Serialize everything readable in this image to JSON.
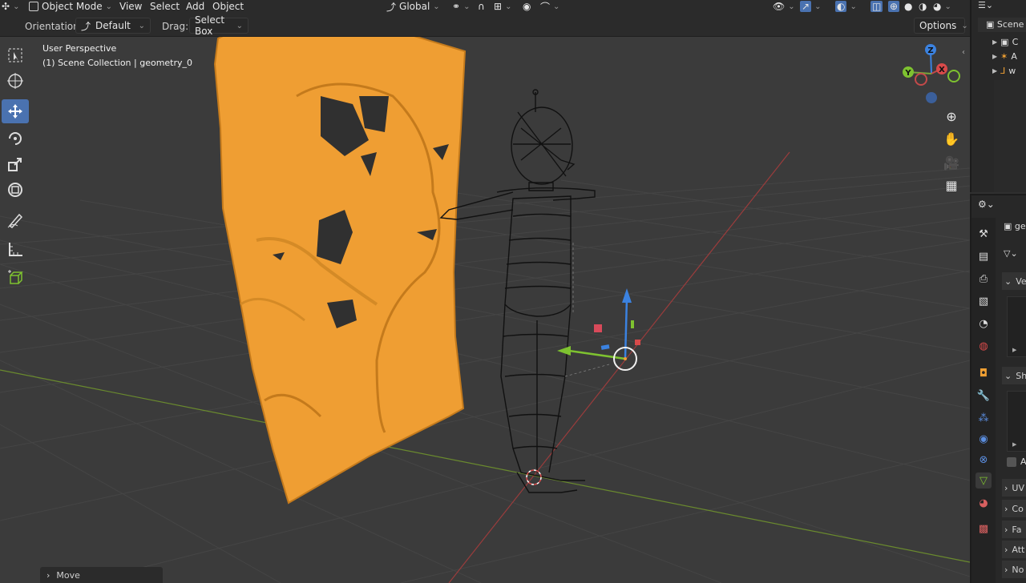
{
  "header": {
    "mode": "Object Mode",
    "menus": [
      "View",
      "Select",
      "Add",
      "Object"
    ],
    "transform_orientation": "Global",
    "orientation_label": "Orientation:",
    "orientation_value": "Default",
    "drag_label": "Drag:",
    "drag_value": "Select Box",
    "options_label": "Options"
  },
  "viewport": {
    "perspective": "User Perspective",
    "collection": "(1) Scene Collection | geometry_0",
    "gizmo_axes": [
      "Z",
      "X",
      "Y"
    ],
    "last_operator": "Move"
  },
  "toolbar": {
    "tools": [
      "select-box",
      "cursor",
      "move",
      "rotate",
      "scale",
      "transform",
      "annotate",
      "measure",
      "add-cube"
    ],
    "active": "move"
  },
  "outliner": {
    "items": [
      "Scene",
      "A",
      "w"
    ]
  },
  "properties": {
    "object_name_fragment": "ge",
    "panels": [
      "Ve",
      "Sh",
      "Ad",
      "UV",
      "Co",
      "Fa",
      "Att",
      "No"
    ]
  },
  "colors": {
    "accent": "#4a72b0",
    "selection_orange": "#f0a033",
    "axis_x": "#c44a4a",
    "axis_y": "#7aa63a",
    "grid": "#464646"
  }
}
